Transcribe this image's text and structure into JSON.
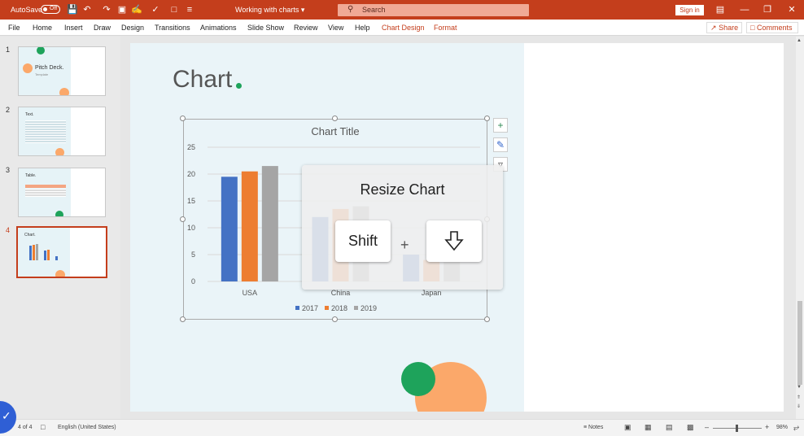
{
  "titlebar": {
    "autosave_label": "AutoSave",
    "autosave_state": "Off",
    "doc_title": "Working with charts",
    "search_placeholder": "Search",
    "signin_label": "Sign in"
  },
  "ribbon": {
    "tabs": [
      "File",
      "Home",
      "Insert",
      "Draw",
      "Design",
      "Transitions",
      "Animations",
      "Slide Show",
      "Review",
      "View",
      "Help",
      "Chart Design",
      "Format"
    ],
    "share_label": "Share",
    "comments_label": "Comments"
  },
  "thumbnails": [
    {
      "num": "1",
      "title": "Pitch Deck.",
      "subtitle": "Template"
    },
    {
      "num": "2",
      "title": "Text."
    },
    {
      "num": "3",
      "title": "Table."
    },
    {
      "num": "4",
      "title": "Chart."
    }
  ],
  "slide": {
    "title": "Chart"
  },
  "chart_data": {
    "type": "bar",
    "title": "Chart Title",
    "categories": [
      "USA",
      "China",
      "Japan"
    ],
    "series": [
      {
        "name": "2017",
        "color": "#4472c4",
        "values": [
          19.5,
          12,
          5
        ]
      },
      {
        "name": "2018",
        "color": "#ed7d31",
        "values": [
          20.5,
          13.5,
          4
        ]
      },
      {
        "name": "2019",
        "color": "#a5a5a5",
        "values": [
          21.5,
          14,
          4
        ]
      }
    ],
    "yticks": [
      "0",
      "5",
      "10",
      "15",
      "20",
      "25"
    ],
    "ylim": [
      0,
      25
    ],
    "legend": "bottom"
  },
  "overlay": {
    "title": "Resize Chart",
    "key1": "Shift",
    "plus": "+",
    "key2_icon": "down-arrow-icon"
  },
  "status": {
    "slide_info": "4 of 4",
    "language": "English (United States)",
    "notes_label": "Notes",
    "zoom": "98%"
  }
}
